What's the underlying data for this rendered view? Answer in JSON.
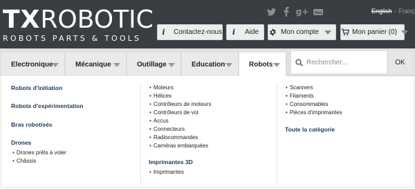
{
  "header": {
    "logo_main": "TXROBOTIC",
    "logo_tx": "TX",
    "logo_rest": "ROBOTIC",
    "logo_sub": "ROBOTS PARTS & TOOLS",
    "social": [
      {
        "name": "twitter-icon",
        "glyph": "🐦"
      },
      {
        "name": "facebook-icon",
        "glyph": "f"
      },
      {
        "name": "google-plus-icon",
        "glyph": "g+"
      },
      {
        "name": "youtube-icon",
        "glyph": "You"
      }
    ],
    "languages": {
      "current": "English",
      "separator": "-",
      "other": "Français"
    },
    "buttons": {
      "contact": "Contactez-nous",
      "help": "Aide",
      "account": "Mon compte",
      "cart": "Mon panier (0)"
    }
  },
  "nav": {
    "tabs": [
      "Electronique",
      "Mécanique",
      "Outillage",
      "Education",
      "Robots"
    ],
    "active_tab": "Robots",
    "search_placeholder": "Rechercher...",
    "search_button": "OK"
  },
  "menu": {
    "col1": {
      "headings": [
        "Robots d'initiation",
        "Robots d'expérimentation",
        "Bras robotisés",
        "Drones"
      ],
      "drones_items": [
        "Drones prêts à voler",
        "Châssis"
      ]
    },
    "col2": {
      "items": [
        "Moteurs",
        "Hélices",
        "Contrôleurs de moteurs",
        "Contrôleurs de vol",
        "Accus",
        "Connecteurs",
        "Radiocommandes",
        "Caméras embarquées"
      ],
      "section_heading": "Imprimantes 3D",
      "section_items": [
        "Imprimantes"
      ]
    },
    "col3": {
      "items": [
        "Scanners",
        "Filaments",
        "Consommables",
        "Pièces d'imprimantes"
      ],
      "all_link": "Toute la catégorie"
    }
  },
  "colors": {
    "topbar": "#3a3d41",
    "nav": "#e1e1e1",
    "heading": "#1f3a5c"
  }
}
